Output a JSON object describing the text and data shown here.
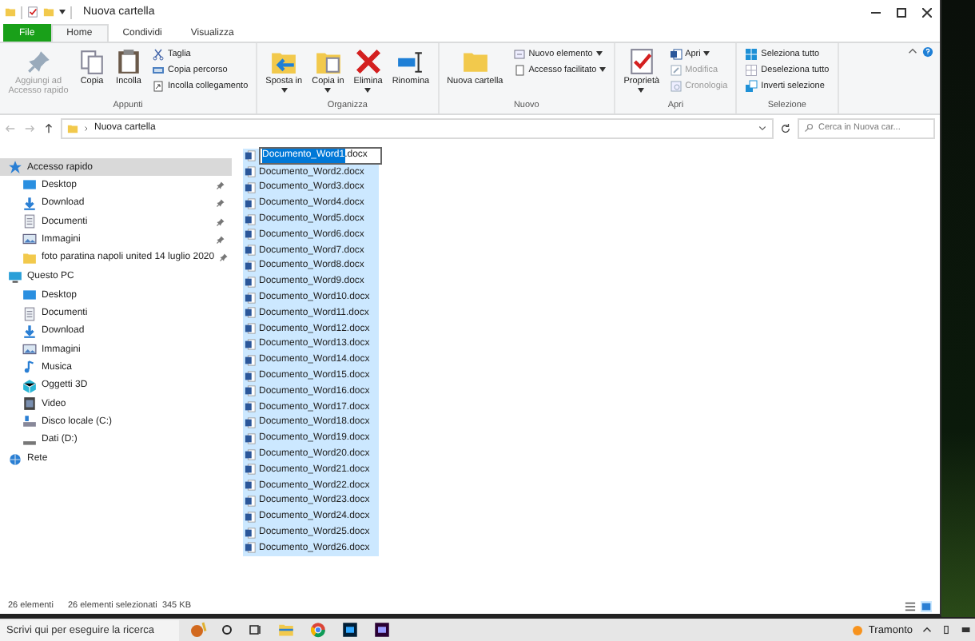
{
  "window": {
    "title": "Nuova cartella"
  },
  "tabs": [
    {
      "label": "File",
      "kind": "file",
      "selected": false
    },
    {
      "label": "Home",
      "kind": "tab",
      "selected": true
    },
    {
      "label": "Condividi",
      "kind": "tab",
      "selected": false
    },
    {
      "label": "Visualizza",
      "kind": "tab",
      "selected": false
    }
  ],
  "ribbon": {
    "groups": [
      {
        "label": "Appunti",
        "buttons": [
          {
            "kind": "large",
            "label": "Aggiungi ad Accesso rapido",
            "disabled": true,
            "dropdown": false
          },
          {
            "kind": "large",
            "label": "Copia",
            "disabled": false,
            "dropdown": false
          },
          {
            "kind": "large",
            "label": "Incolla",
            "disabled": false,
            "dropdown": false
          },
          {
            "kind": "stack",
            "items": [
              {
                "label": "Taglia",
                "disabled": false,
                "dropdown": false
              },
              {
                "label": "Copia percorso",
                "disabled": false,
                "dropdown": false
              },
              {
                "label": "Incolla collegamento",
                "disabled": false,
                "dropdown": false
              }
            ]
          }
        ]
      },
      {
        "label": "Organizza",
        "buttons": [
          {
            "kind": "large",
            "label": "Sposta in",
            "disabled": false,
            "dropdown": true
          },
          {
            "kind": "large",
            "label": "Copia in",
            "disabled": false,
            "dropdown": true
          },
          {
            "kind": "large",
            "label": "Elimina",
            "disabled": false,
            "dropdown": true
          },
          {
            "kind": "large",
            "label": "Rinomina",
            "disabled": false,
            "dropdown": false
          }
        ]
      },
      {
        "label": "Nuovo",
        "buttons": [
          {
            "kind": "large",
            "label": "Nuova cartella",
            "disabled": false,
            "dropdown": false
          },
          {
            "kind": "stack",
            "items": [
              {
                "label": "Nuovo elemento",
                "disabled": false,
                "dropdown": true
              },
              {
                "label": "Accesso facilitato",
                "disabled": false,
                "dropdown": true
              }
            ]
          }
        ]
      },
      {
        "label": "Apri",
        "buttons": [
          {
            "kind": "large",
            "label": "Proprietà",
            "disabled": false,
            "dropdown": true
          },
          {
            "kind": "stack",
            "items": [
              {
                "label": "Apri",
                "disabled": false,
                "dropdown": true
              },
              {
                "label": "Modifica",
                "disabled": true,
                "dropdown": false
              },
              {
                "label": "Cronologia",
                "disabled": true,
                "dropdown": false
              }
            ]
          }
        ]
      },
      {
        "label": "Selezione",
        "buttons": [
          {
            "kind": "stack",
            "items": [
              {
                "label": "Seleziona tutto",
                "disabled": false,
                "dropdown": false
              },
              {
                "label": "Deseleziona tutto",
                "disabled": false,
                "dropdown": false
              },
              {
                "label": "Inverti selezione",
                "disabled": false,
                "dropdown": false
              }
            ]
          }
        ]
      }
    ]
  },
  "address_bar": {
    "breadcrumb": [
      "Nuova cartella"
    ]
  },
  "search": {
    "placeholder": "Cerca in Nuova car..."
  },
  "navigation": [
    {
      "label": "Accesso rapido",
      "selected": true,
      "children": [
        {
          "label": "Desktop",
          "selected": false,
          "pinned": true
        },
        {
          "label": "Download",
          "selected": false,
          "pinned": true
        },
        {
          "label": "Documenti",
          "selected": false,
          "pinned": true
        },
        {
          "label": "Immagini",
          "selected": false,
          "pinned": true
        },
        {
          "label": "foto paratina napoli united 14 luglio 2020",
          "selected": false,
          "pinned": true
        }
      ]
    },
    {
      "label": "Questo PC",
      "selected": false,
      "children": [
        {
          "label": "Desktop",
          "selected": false,
          "pinned": false
        },
        {
          "label": "Documenti",
          "selected": false,
          "pinned": false
        },
        {
          "label": "Download",
          "selected": false,
          "pinned": false
        },
        {
          "label": "Immagini",
          "selected": false,
          "pinned": false
        },
        {
          "label": "Musica",
          "selected": false,
          "pinned": false
        },
        {
          "label": "Oggetti 3D",
          "selected": false,
          "pinned": false
        },
        {
          "label": "Video",
          "selected": false,
          "pinned": false
        },
        {
          "label": "Disco locale (C:)",
          "selected": false,
          "pinned": false
        },
        {
          "label": "Dati (D:)",
          "selected": false,
          "pinned": false
        }
      ]
    },
    {
      "label": "Rete",
      "selected": false
    }
  ],
  "files": [
    {
      "kind": "rename",
      "selected": true,
      "selected_text": "Documento_Word1",
      "rest": ".docx"
    },
    {
      "kind": "file",
      "selected": true,
      "name": "Documento_Word2.docx"
    },
    {
      "kind": "file",
      "selected": true,
      "name": "Documento_Word3.docx"
    },
    {
      "kind": "file",
      "selected": true,
      "name": "Documento_Word4.docx"
    },
    {
      "kind": "file",
      "selected": true,
      "name": "Documento_Word5.docx"
    },
    {
      "kind": "file",
      "selected": true,
      "name": "Documento_Word6.docx"
    },
    {
      "kind": "file",
      "selected": true,
      "name": "Documento_Word7.docx"
    },
    {
      "kind": "file",
      "selected": true,
      "name": "Documento_Word8.docx"
    },
    {
      "kind": "file",
      "selected": true,
      "name": "Documento_Word9.docx"
    },
    {
      "kind": "file",
      "selected": true,
      "name": "Documento_Word10.docx"
    },
    {
      "kind": "file",
      "selected": true,
      "name": "Documento_Word11.docx"
    },
    {
      "kind": "file",
      "selected": true,
      "name": "Documento_Word12.docx"
    },
    {
      "kind": "file",
      "selected": true,
      "name": "Documento_Word13.docx"
    },
    {
      "kind": "file",
      "selected": true,
      "name": "Documento_Word14.docx"
    },
    {
      "kind": "file",
      "selected": true,
      "name": "Documento_Word15.docx"
    },
    {
      "kind": "file",
      "selected": true,
      "name": "Documento_Word16.docx"
    },
    {
      "kind": "file",
      "selected": true,
      "name": "Documento_Word17.docx"
    },
    {
      "kind": "file",
      "selected": true,
      "name": "Documento_Word18.docx"
    },
    {
      "kind": "file",
      "selected": true,
      "name": "Documento_Word19.docx"
    },
    {
      "kind": "file",
      "selected": true,
      "name": "Documento_Word20.docx"
    },
    {
      "kind": "file",
      "selected": true,
      "name": "Documento_Word21.docx"
    },
    {
      "kind": "file",
      "selected": true,
      "name": "Documento_Word22.docx"
    },
    {
      "kind": "file",
      "selected": true,
      "name": "Documento_Word23.docx"
    },
    {
      "kind": "file",
      "selected": true,
      "name": "Documento_Word24.docx"
    },
    {
      "kind": "file",
      "selected": true,
      "name": "Documento_Word25.docx"
    },
    {
      "kind": "file",
      "selected": true,
      "name": "Documento_Word26.docx"
    }
  ],
  "status_bar": {
    "items": [
      "26 elementi",
      "26 elementi selezionati  345 KB"
    ],
    "view_buttons": [
      {
        "selected": false
      },
      {
        "selected": true
      }
    ]
  },
  "taskbar": {
    "search": {
      "placeholder": "Scrivi qui per eseguire la ricerca"
    },
    "weather": "Tramonto"
  }
}
